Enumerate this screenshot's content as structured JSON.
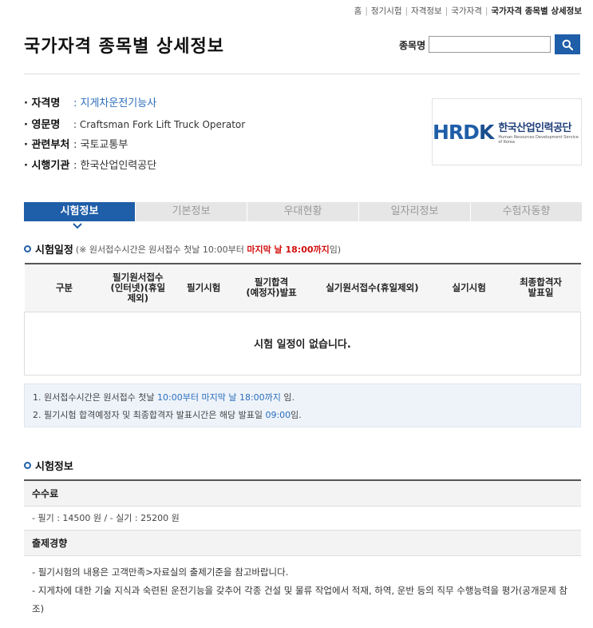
{
  "breadcrumb": {
    "items": [
      "홈",
      "정기시험",
      "자격정보",
      "국가자격"
    ],
    "current": "국가자격 종목별 상세정보"
  },
  "page_title": "국가자격 종목별 상세정보",
  "search": {
    "label": "종목명",
    "value": "",
    "placeholder": ""
  },
  "qualification": {
    "name_label": "· 자격명",
    "name_value": ": 지게차운전기능사",
    "eng_label": "· 영문명",
    "eng_value": ": Craftsman Fork Lift Truck Operator",
    "ministry_label": "· 관련부처",
    "ministry_value": ": 국토교통부",
    "agency_label": "· 시행기관",
    "agency_value": ": 한국산업인력공단"
  },
  "logo": {
    "mark_left": "HRD",
    "mark_right": "K",
    "korean": "한국산업인력공단",
    "english": "Human Resources Development Service of Korea"
  },
  "tabs": [
    {
      "label": "시험정보",
      "active": true
    },
    {
      "label": "기본정보",
      "active": false
    },
    {
      "label": "우대현황",
      "active": false
    },
    {
      "label": "일자리정보",
      "active": false
    },
    {
      "label": "수험자동향",
      "active": false
    }
  ],
  "schedule": {
    "title": "시험일정",
    "note_pre": "(※ 원서접수시간은 원서접수 첫날 10:00부터 ",
    "note_red": "마지막 날 18:00까지",
    "note_post": "임)",
    "columns": [
      "구분",
      "필기원서접수\n(인터넷)(휴일\n제외)",
      "필기시험",
      "필기합격\n(예정자)발표",
      "실기원서접수(휴일제외)",
      "실기시험",
      "최종합격자\n발표일"
    ],
    "empty_message": "시험 일정이 없습니다."
  },
  "notes": {
    "line1_pre": "1. 원서접수시간은 원서접수 첫날 ",
    "line1_blue": "10:00부터 마지막 날 18:00까지",
    "line1_post": " 임.",
    "line2_pre": "2. 필기시험 합격예정자 및 최종합격자 발표시간은 해당 발표일 ",
    "line2_blue": "09:00",
    "line2_post": "임."
  },
  "exam_info": {
    "title": "시험정보",
    "fee_header": "수수료",
    "fee_text": "- 필기 : 14500 원 / - 실기 : 25200 원",
    "trend_header": "출제경향",
    "trend_line1": "- 필기시험의 내용은 고객만족>자료실의 출제기준을 참고바랍니다.",
    "trend_line2": "- 지게차에 대한 기술 지식과 숙련된 운전기능을 갖추어 각종 건설 및 물류 작업에서 적재, 하역, 운반 등의 직무 수행능력을 평가(공개문제 참조)"
  },
  "colors": {
    "accent": "#1f5ea8",
    "note_red": "#d20f0f",
    "link_blue": "#2a6ebb"
  }
}
